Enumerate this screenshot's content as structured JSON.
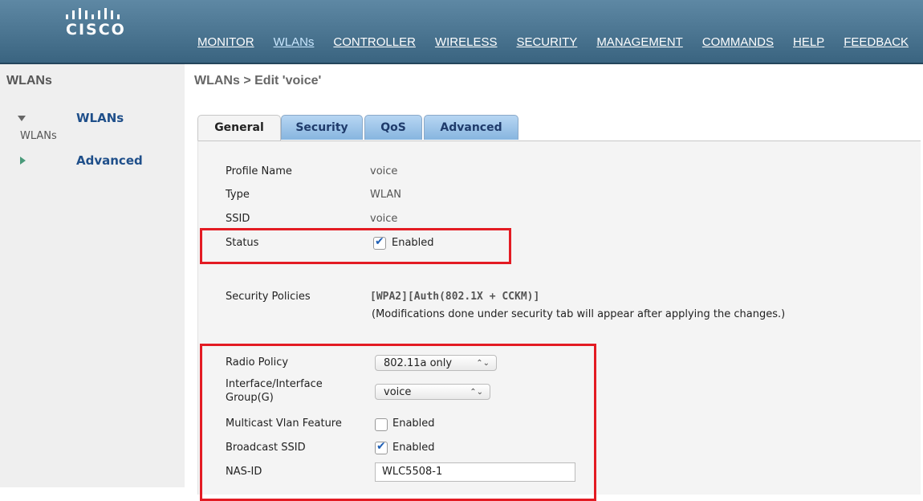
{
  "logo": {
    "word": "CISCO"
  },
  "nav": {
    "items": [
      "MONITOR",
      "WLANs",
      "CONTROLLER",
      "WIRELESS",
      "SECURITY",
      "MANAGEMENT",
      "COMMANDS",
      "HELP",
      "FEEDBACK"
    ],
    "active": "WLANs"
  },
  "sidebar": {
    "title": "WLANs",
    "wlans_heading": "WLANs",
    "wlans_sub": "WLANs",
    "advanced_heading": "Advanced"
  },
  "page": {
    "title": "WLANs > Edit  'voice'"
  },
  "tabs": [
    "General",
    "Security",
    "QoS",
    "Advanced"
  ],
  "active_tab": "General",
  "general": {
    "profile_name_label": "Profile Name",
    "profile_name": "voice",
    "type_label": "Type",
    "type": "WLAN",
    "ssid_label": "SSID",
    "ssid": "voice",
    "status_label": "Status",
    "status_text": "Enabled",
    "security_policies_label": "Security Policies",
    "security_policies": "[WPA2][Auth(802.1X + CCKM)]",
    "security_note": "(Modifications done under security tab will appear after applying the changes.)",
    "radio_policy_label": "Radio Policy",
    "radio_policy": "802.11a only",
    "interface_label_line1": "Interface/Interface",
    "interface_label_line2": "Group(G)",
    "interface": "voice",
    "multicast_label": "Multicast Vlan Feature",
    "multicast_text": "Enabled",
    "broadcast_label": "Broadcast SSID",
    "broadcast_text": "Enabled",
    "nasid_label": "NAS-ID",
    "nasid": "WLC5508-1"
  },
  "colors": {
    "highlight": "#e31b23",
    "header": "#3a6480",
    "tab": "#87b5df"
  }
}
